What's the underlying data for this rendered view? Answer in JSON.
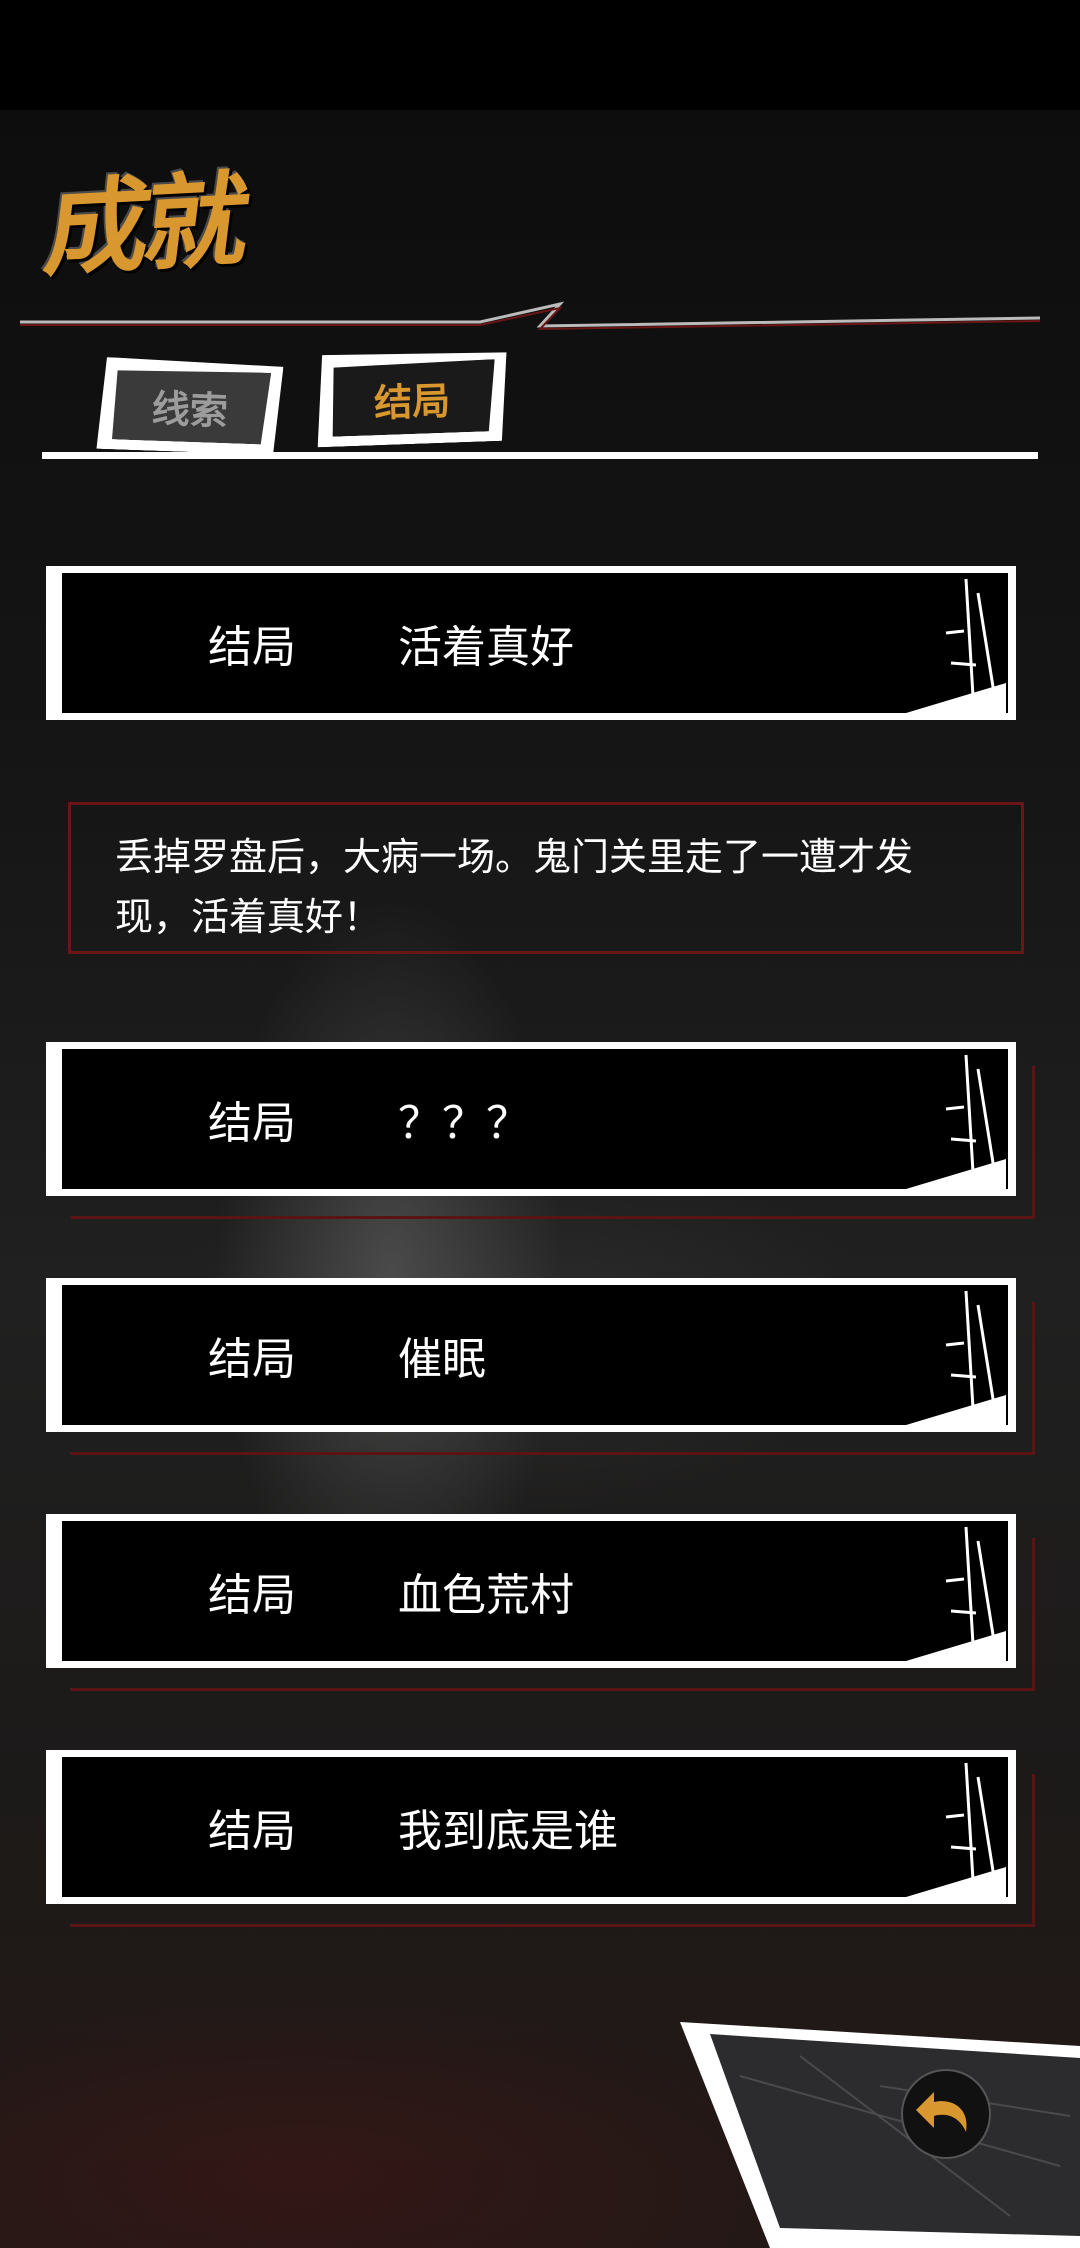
{
  "page": {
    "title": "成就"
  },
  "tabs": [
    {
      "label": "线索",
      "active": false
    },
    {
      "label": "结局",
      "active": true
    }
  ],
  "endings": [
    {
      "label": "结局",
      "title": "活着真好",
      "unlocked": true,
      "expanded": true,
      "description": "丢掉罗盘后，大病一场。鬼门关里走了一遭才发现，活着真好！"
    },
    {
      "label": "结局",
      "title": "？？？",
      "unlocked": false
    },
    {
      "label": "结局",
      "title": "催眠",
      "unlocked": true
    },
    {
      "label": "结局",
      "title": "血色荒村",
      "unlocked": true
    },
    {
      "label": "结局",
      "title": "我到底是谁",
      "unlocked": true
    }
  ],
  "colors": {
    "accent": "#d9972f",
    "border_red": "#6b1616",
    "card_bg": "#000000",
    "card_frame": "#ffffff"
  },
  "icons": {
    "back": "back-arrow-icon"
  }
}
